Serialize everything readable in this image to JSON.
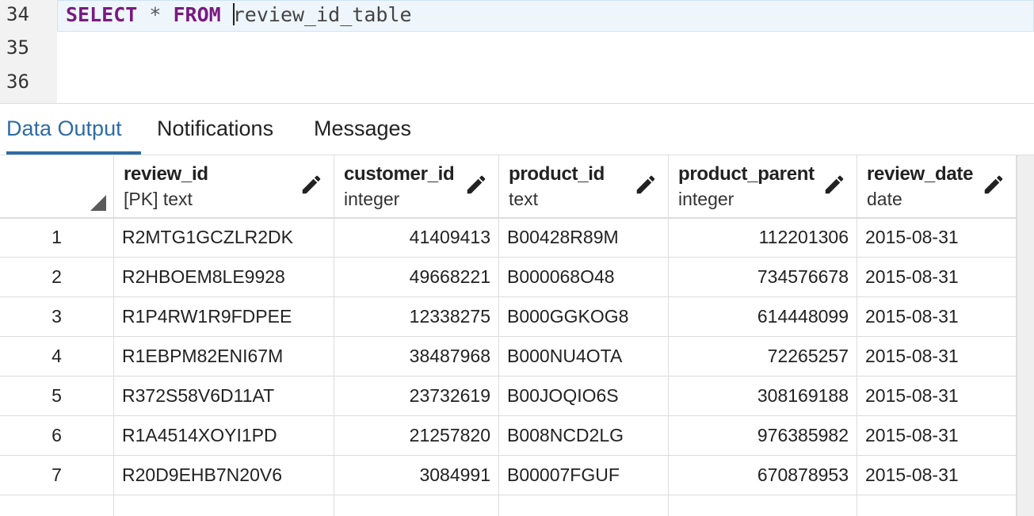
{
  "editor": {
    "lines": [
      {
        "number": "34",
        "tokens": [
          {
            "text": "SELECT",
            "kind": "kw"
          },
          {
            "text": " * ",
            "kind": "op"
          },
          {
            "text": "FROM",
            "kind": "kw"
          },
          {
            "text": " ",
            "kind": "op"
          },
          {
            "text": "review_id_table",
            "kind": "ident",
            "cursor_before": true
          }
        ]
      },
      {
        "number": "35",
        "tokens": []
      },
      {
        "number": "36",
        "tokens": []
      }
    ]
  },
  "tabs": [
    {
      "label": "Data Output",
      "active": true
    },
    {
      "label": "Notifications",
      "active": false
    },
    {
      "label": "Messages",
      "active": false
    }
  ],
  "grid": {
    "columns": [
      {
        "name": "review_id",
        "type": "[PK] text",
        "align": "left"
      },
      {
        "name": "customer_id",
        "type": "integer",
        "align": "right"
      },
      {
        "name": "product_id",
        "type": "text",
        "align": "left"
      },
      {
        "name": "product_parent",
        "type": "integer",
        "align": "right"
      },
      {
        "name": "review_date",
        "type": "date",
        "align": "left"
      }
    ],
    "rows": [
      {
        "num": "1",
        "cells": [
          "R2MTG1GCZLR2DK",
          "41409413",
          "B00428R89M",
          "112201306",
          "2015-08-31"
        ]
      },
      {
        "num": "2",
        "cells": [
          "R2HBOEM8LE9928",
          "49668221",
          "B000068O48",
          "734576678",
          "2015-08-31"
        ]
      },
      {
        "num": "3",
        "cells": [
          "R1P4RW1R9FDPEE",
          "12338275",
          "B000GGKOG8",
          "614448099",
          "2015-08-31"
        ]
      },
      {
        "num": "4",
        "cells": [
          "R1EBPM82ENI67M",
          "38487968",
          "B000NU4OTA",
          "72265257",
          "2015-08-31"
        ]
      },
      {
        "num": "5",
        "cells": [
          "R372S58V6D11AT",
          "23732619",
          "B00JOQIO6S",
          "308169188",
          "2015-08-31"
        ]
      },
      {
        "num": "6",
        "cells": [
          "R1A4514XOYI1PD",
          "21257820",
          "B008NCD2LG",
          "976385982",
          "2015-08-31"
        ]
      },
      {
        "num": "7",
        "cells": [
          "R20D9EHB7N20V6",
          "3084991",
          "B00007FGUF",
          "670878953",
          "2015-08-31"
        ]
      }
    ]
  },
  "colors": {
    "accent": "#2e6ca4",
    "keyword": "#7a1a80",
    "gutter": "#f2f2f2",
    "active_line": "#eef6fc"
  },
  "icons": {
    "edit": "pencil-icon",
    "sort": "corner-triangle-icon"
  }
}
